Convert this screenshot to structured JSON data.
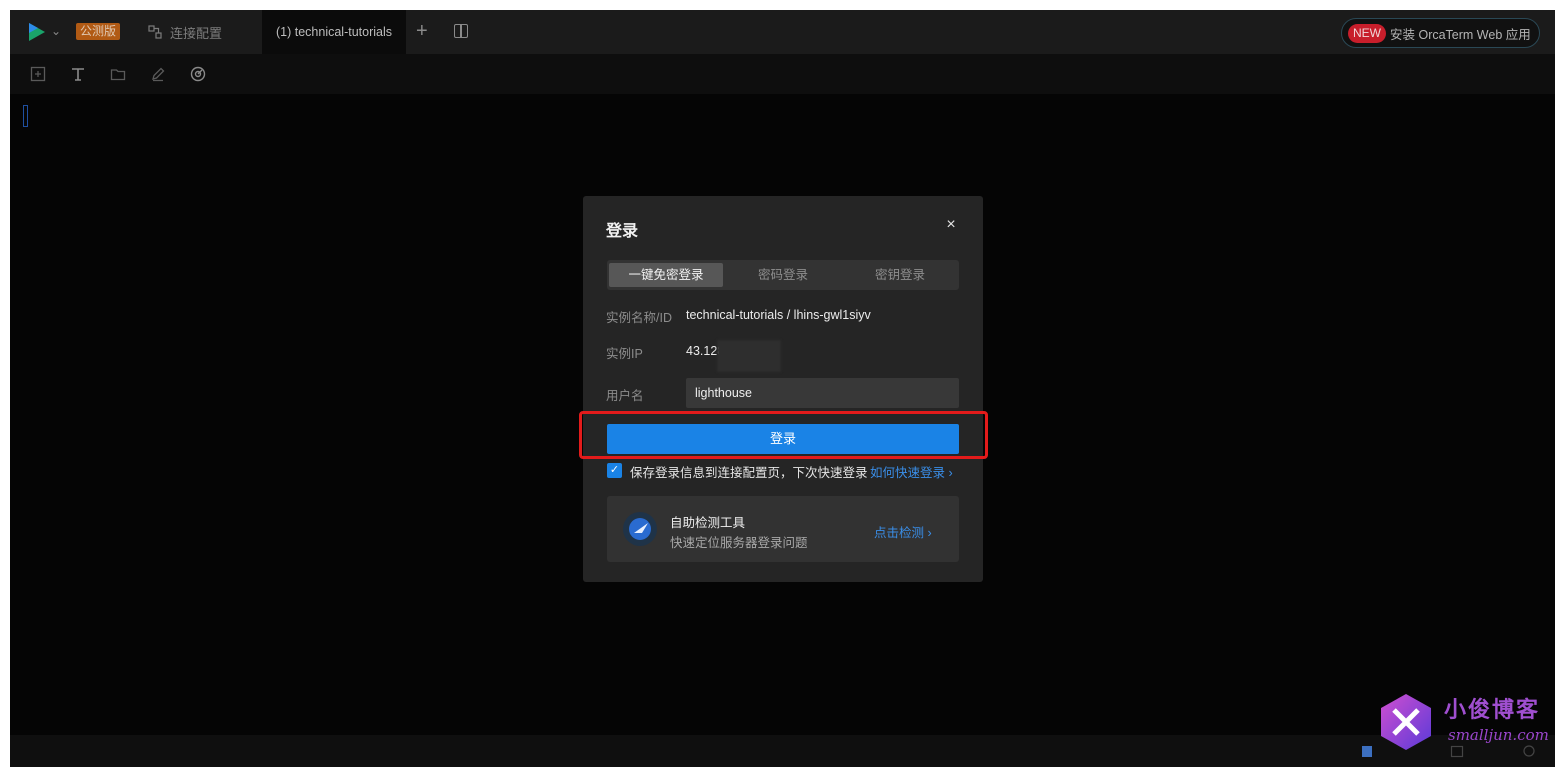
{
  "topbar": {
    "beta_badge": "公测版",
    "connection_tab_label": "连接配置",
    "session_tab_label": "(1) technical-tutorials",
    "promo": {
      "new_badge": "NEW",
      "text": "安装 OrcaTerm Web 应用"
    }
  },
  "toolbar": {
    "icons": [
      "screen-icon",
      "text-icon",
      "folder-icon",
      "edit-icon",
      "gauge-icon"
    ]
  },
  "modal": {
    "title": "登录",
    "close_symbol": "×",
    "tabs": [
      {
        "label": "一键免密登录",
        "active": true
      },
      {
        "label": "密码登录",
        "active": false
      },
      {
        "label": "密钥登录",
        "active": false
      }
    ],
    "instance_name_label": "实例名称/ID",
    "instance_name_value": "technical-tutorials / lhins-gwl1siyv",
    "instance_ip_label": "实例IP",
    "instance_ip_value": "43.128",
    "username_label": "用户名",
    "username_value": "lighthouse",
    "login_button": "登录",
    "save_checkbox": {
      "checked": true,
      "label": "保存登录信息到连接配置页，下次快速登录"
    },
    "quick_login_link": "如何快速登录 ›",
    "self_check": {
      "title": "自助检测工具",
      "subtitle": "快速定位服务器登录问题",
      "link": "点击检测 ›"
    }
  },
  "watermark": {
    "title": "小俊博客",
    "url": "smalljun.com"
  },
  "colors": {
    "accent": "#1a83e6",
    "highlight_border": "#e31b1b",
    "background": "#050505",
    "modal_bg": "#252525"
  }
}
